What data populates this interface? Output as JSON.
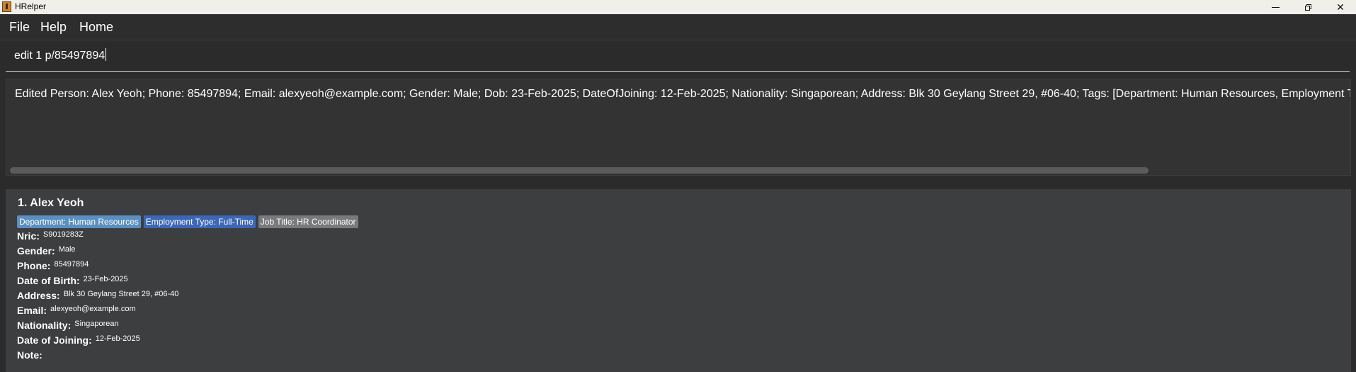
{
  "window": {
    "title": "HRelper",
    "controls": [
      "minimize-icon",
      "maximize-icon",
      "close-icon"
    ]
  },
  "menu": {
    "file": "File",
    "help": "Help",
    "home": "Home"
  },
  "command": {
    "value": "edit 1 p/85497894"
  },
  "result": {
    "text": "Edited Person: Alex Yeoh; Phone: 85497894; Email: alexyeoh@example.com; Gender: Male; Dob: 23-Feb-2025; DateOfJoining: 12-Feb-2025; Nationality: Singaporean; Address: Blk 30 Geylang Street 29, #06-40; Tags: [Department: Human Resources, Employment Type: Full-Time, Job Title: HR Coordinator]"
  },
  "person": {
    "index": "1.",
    "name": "Alex Yeoh",
    "header": "1.  Alex Yeoh",
    "tags": {
      "department": "Department: Human Resources",
      "employment": "Employment Type: Full-Time",
      "job": "Job Title: HR Coordinator"
    },
    "fields": {
      "nric_label": "Nric:",
      "nric": "S9019283Z",
      "gender_label": "Gender:",
      "gender": "Male",
      "phone_label": "Phone:",
      "phone": "85497894",
      "dob_label": "Date of Birth:",
      "dob": "23-Feb-2025",
      "address_label": "Address:",
      "address": "Blk 30 Geylang Street 29, #06-40",
      "email_label": "Email:",
      "email": "alexyeoh@example.com",
      "nationality_label": "Nationality:",
      "nationality": "Singaporean",
      "doj_label": "Date of Joining:",
      "doj": "12-Feb-2025",
      "note_label": "Note:",
      "note": ""
    }
  },
  "colors": {
    "background": "#2b2b2b",
    "card": "#3c3e3f",
    "tag_department": "#5a8fc1",
    "tag_employment": "#3c67b8",
    "tag_job": "#7a7a7a"
  }
}
